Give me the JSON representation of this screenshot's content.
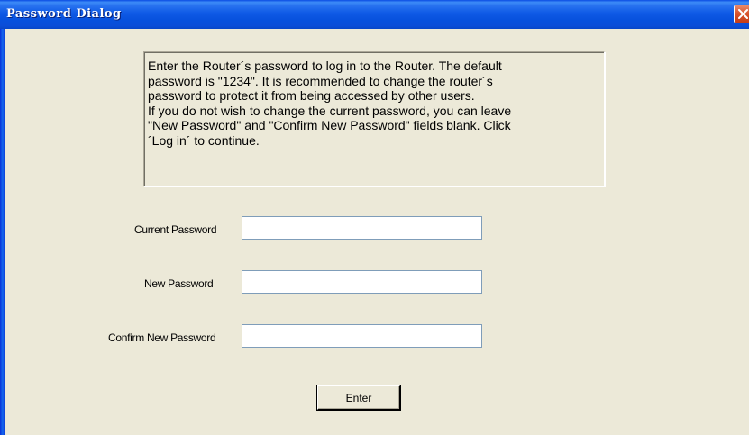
{
  "window": {
    "title": "Password Dialog"
  },
  "info": {
    "text": "Enter the Router´s password to log in to the Router. The default\npassword is \"1234\". It is recommended to change the router´s\npassword to protect it from being accessed by other users.\nIf you do not wish to change the current password, you can leave\n\"New Password\" and \"Confirm New Password\" fields blank. Click\n´Log in´ to continue."
  },
  "form": {
    "current_password_label": "Current Password",
    "current_password_value": "",
    "new_password_label": "New Password",
    "new_password_value": "",
    "confirm_password_label": "Confirm New Password",
    "confirm_password_value": "",
    "enter_label": "Enter"
  },
  "icons": {
    "close": "close-icon"
  },
  "colors": {
    "titlebar": "#0A4ED8",
    "dialog_bg": "#ECE9D8",
    "close_button": "#D9542D",
    "input_border": "#7F9DB9"
  }
}
